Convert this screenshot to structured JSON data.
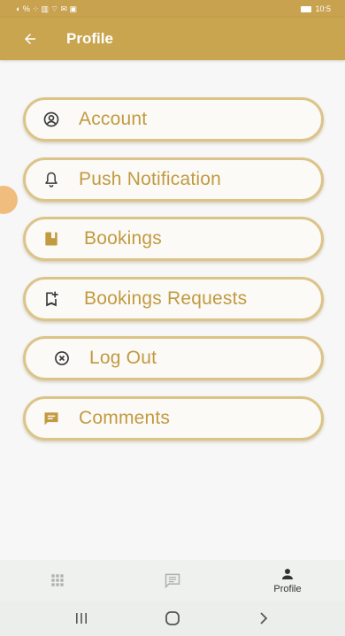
{
  "status_bar": {
    "left_icons": "◐ % ⁘ ▥ ⌔ ✉ ▣",
    "time": "10:5"
  },
  "app_bar": {
    "title": "Profile",
    "back_icon": "arrow-left-icon"
  },
  "menu": {
    "items": [
      {
        "label": "Account",
        "icon": "account-circle-icon"
      },
      {
        "label": "Push Notification",
        "icon": "bell-icon"
      },
      {
        "label": "Bookings",
        "icon": "book-icon"
      },
      {
        "label": "Bookings Requests",
        "icon": "bookmark-add-icon"
      },
      {
        "label": "Log Out",
        "icon": "close-circle-icon"
      },
      {
        "label": "Comments",
        "icon": "comment-icon"
      }
    ]
  },
  "bottom_nav": {
    "items": [
      {
        "label": "",
        "icon": "grid-icon"
      },
      {
        "label": "",
        "icon": "message-icon"
      },
      {
        "label": "Profile",
        "icon": "person-icon"
      }
    ]
  },
  "colors": {
    "accent": "#c9a54f",
    "menu_text": "#c29a3f",
    "menu_border": "#dcc489"
  }
}
